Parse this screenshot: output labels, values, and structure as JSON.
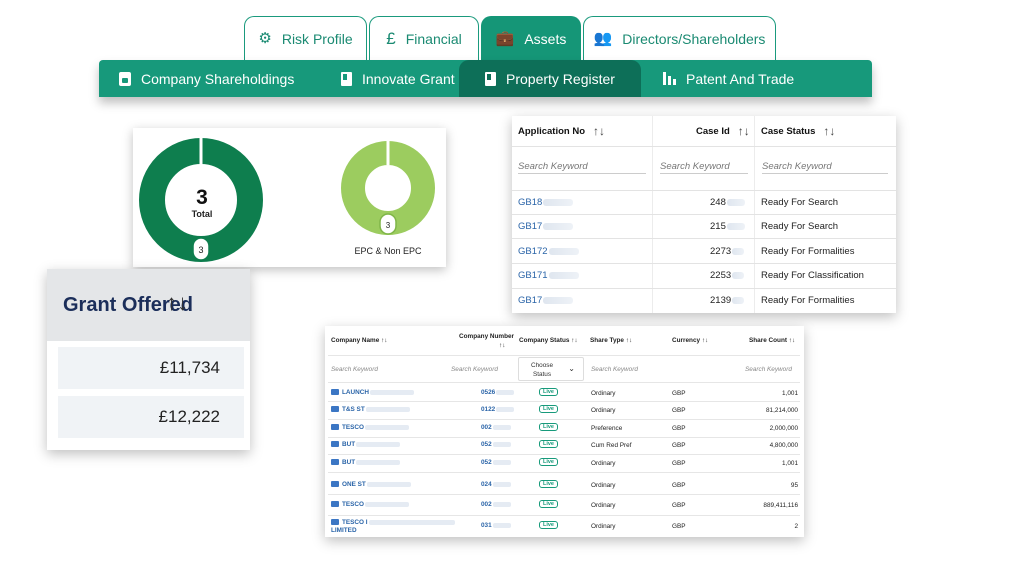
{
  "top_tabs": [
    {
      "label": "Risk Profile",
      "icon": "user-gear-icon"
    },
    {
      "label": "Financial",
      "icon": "pound-sign-icon"
    },
    {
      "label": "Assets",
      "icon": "briefcase-icon"
    },
    {
      "label": "Directors/Shareholders",
      "icon": "users-icon"
    }
  ],
  "sub_tabs": [
    {
      "label": "Company Shareholdings",
      "icon": "document-icon"
    },
    {
      "label": "Innovate Grant",
      "icon": "book-icon"
    },
    {
      "label": "Property Register",
      "icon": "book-icon"
    },
    {
      "label": "Patent And Trade",
      "icon": "bar-chart-icon"
    }
  ],
  "colors": {
    "brand": "#159677",
    "brand_dark": "#0d6f58",
    "donut_dark": "#0e7e4e",
    "donut_light": "#9ccc5f",
    "link": "#2a64a8"
  },
  "chart_data": [
    {
      "type": "pie",
      "total_value": "3",
      "total_label": "Total",
      "slice_label": "3",
      "values": [
        3
      ],
      "colors": [
        "#0e7e4e"
      ]
    },
    {
      "type": "pie",
      "slice_label": "3",
      "label": "EPC & Non EPC",
      "values": [
        3
      ],
      "colors": [
        "#9ccc5f"
      ]
    }
  ],
  "grant": {
    "title": "Grant Offered",
    "sort_icon": "↑↓",
    "rows": [
      "£11,734",
      "£12,222"
    ]
  },
  "property": {
    "headers": {
      "application_no": "Application No",
      "case_id": "Case Id",
      "case_status": "Case Status"
    },
    "sort_icon": "↑↓",
    "search_placeholder": "Search Keyword",
    "rows": [
      {
        "app": "GB18",
        "case": "248",
        "status": "Ready For Search"
      },
      {
        "app": "GB17",
        "case": "215",
        "status": "Ready For Search"
      },
      {
        "app": "GB172",
        "case": "2273",
        "status": "Ready For Formalities"
      },
      {
        "app": "GB171",
        "case": "2253",
        "status": "Ready For Classification"
      },
      {
        "app": "GB17",
        "case": "2139",
        "status": "Ready For Formalities"
      }
    ]
  },
  "shareholdings": {
    "headers": {
      "company_name": "Company Name",
      "company_number": "Company Number",
      "company_status": "Company Status",
      "share_type": "Share Type",
      "currency": "Currency",
      "share_count": "Share Count"
    },
    "sort_icon": "↑↓",
    "search_placeholder": "Search Keyword",
    "status_select": "Choose Status",
    "rows": [
      {
        "name": "LAUNCH",
        "number": "0526",
        "status": "Live",
        "type": "Ordinary",
        "currency": "GBP",
        "count": "1,001"
      },
      {
        "name": "T&S ST",
        "number": "0122",
        "status": "Live",
        "type": "Ordinary",
        "currency": "GBP",
        "count": "81,214,000"
      },
      {
        "name": "TESCO",
        "number": "002",
        "status": "Live",
        "type": "Preference",
        "currency": "GBP",
        "count": "2,000,000"
      },
      {
        "name": "BUT",
        "number": "052",
        "status": "Live",
        "type": "Cum Red Pref",
        "currency": "GBP",
        "count": "4,800,000"
      },
      {
        "name": "BUT",
        "number": "052",
        "status": "Live",
        "type": "Ordinary",
        "currency": "GBP",
        "count": "1,001"
      },
      {
        "name": "ONE ST",
        "number": "024",
        "status": "Live",
        "type": "Ordinary",
        "currency": "GBP",
        "count": "95"
      },
      {
        "name": "TESCO",
        "number": "002",
        "status": "Live",
        "type": "Ordinary",
        "currency": "GBP",
        "count": "889,411,116"
      },
      {
        "name": "TESCO I",
        "name_line2": "LIMITED",
        "number": "031",
        "status": "Live",
        "type": "Ordinary",
        "currency": "GBP",
        "count": "2"
      }
    ]
  }
}
